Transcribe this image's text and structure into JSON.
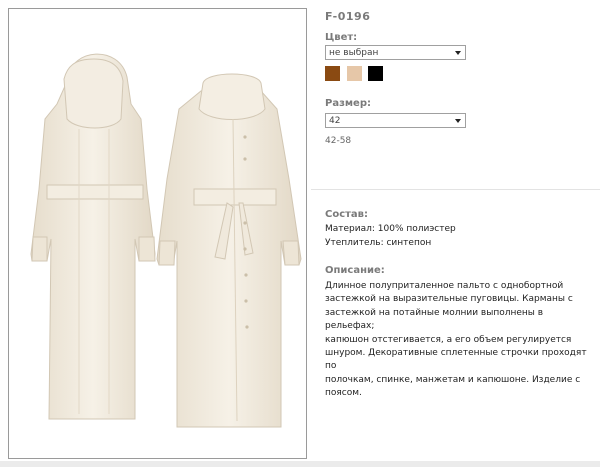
{
  "product": {
    "sku": "F-0196",
    "color_label": "Цвет:",
    "color_selected": "не выбран",
    "colors": [
      "#8a4a12",
      "#e6c7a8",
      "#000000"
    ],
    "size_label": "Размер:",
    "size_selected": "42",
    "size_range": "42-58"
  },
  "composition": {
    "heading": "Состав:",
    "material": "Материал: 100% полиэстер",
    "insulation": "Утеплитель: синтепон"
  },
  "description": {
    "heading": "Описание:",
    "lines": [
      "Длинное полуприталенное пальто с однобортной",
      "застежкой на выразительные пуговицы. Карманы с",
      "застежкой на потайные молнии выполнены в рельефах;",
      "капюшон отстегивается, а его объем регулируется",
      "шнуром. Декоративные сплетенные строчки проходят по",
      "полочкам, спинке, манжетам и капюшоне. Изделие с",
      "поясом."
    ]
  }
}
